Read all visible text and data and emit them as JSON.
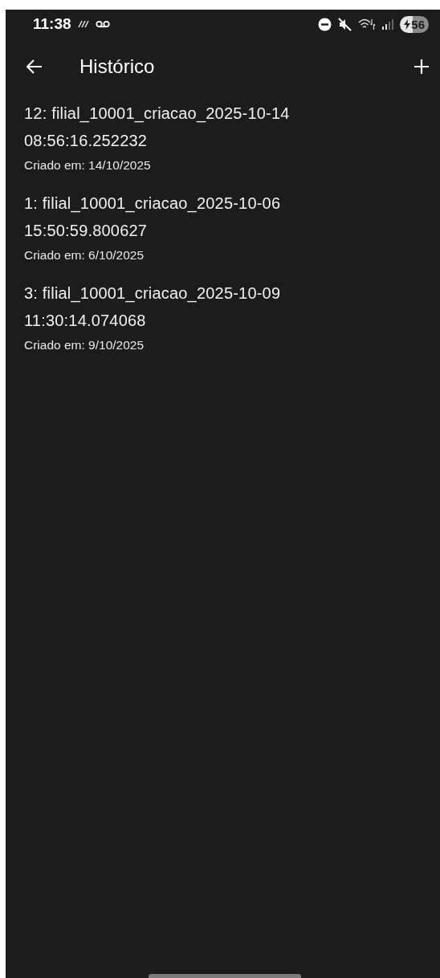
{
  "status_bar": {
    "time": "11:38",
    "battery": "56"
  },
  "app_bar": {
    "title": "Histórico"
  },
  "items": [
    {
      "title": "12: filial_10001_criacao_2025-10-14 08:56:16.252232",
      "subtitle": "Criado em: 14/10/2025"
    },
    {
      "title": "1: filial_10001_criacao_2025-10-06 15:50:59.800627",
      "subtitle": "Criado em: 6/10/2025"
    },
    {
      "title": "3: filial_10001_criacao_2025-10-09 11:30:14.074068",
      "subtitle": "Criado em: 9/10/2025"
    }
  ]
}
